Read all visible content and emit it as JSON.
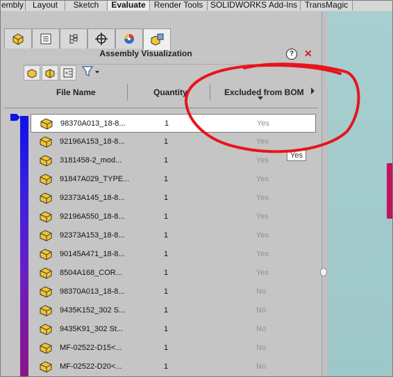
{
  "top_tabs": [
    {
      "label": "embly",
      "active": false
    },
    {
      "label": "Layout",
      "active": false
    },
    {
      "label": "Sketch",
      "active": false
    },
    {
      "label": "Evaluate",
      "active": true
    },
    {
      "label": "Render Tools",
      "active": false
    },
    {
      "label": "SOLIDWORKS Add-Ins",
      "active": false
    },
    {
      "label": "TransMagic",
      "active": false
    }
  ],
  "panel": {
    "title": "Assembly Visualization",
    "help_label": "?",
    "close_label": "✕",
    "icon_tabs": [
      "featuremanager-icon",
      "propertymanager-icon",
      "configurationmanager-icon",
      "dimxpert-icon",
      "display-manager-icon",
      "assembly-visualization-icon"
    ]
  },
  "columns": {
    "file_name": "File Name",
    "quantity": "Quantity",
    "excluded": "Excluded from BOM"
  },
  "tooltip": "Yes",
  "rows": [
    {
      "name": "98370A013_18-8...",
      "qty": "1",
      "excluded": "Yes",
      "selected": true
    },
    {
      "name": "92196A153_18-8...",
      "qty": "1",
      "excluded": "Yes",
      "selected": false
    },
    {
      "name": "3181458-2_mod...",
      "qty": "1",
      "excluded": "Yes",
      "selected": false
    },
    {
      "name": "91847A029_TYPE...",
      "qty": "1",
      "excluded": "Yes",
      "selected": false
    },
    {
      "name": "92373A145_18-8...",
      "qty": "1",
      "excluded": "Yes",
      "selected": false
    },
    {
      "name": "92196A550_18-8...",
      "qty": "1",
      "excluded": "Yes",
      "selected": false
    },
    {
      "name": "92373A153_18-8...",
      "qty": "1",
      "excluded": "Yes",
      "selected": false
    },
    {
      "name": "90145A471_18-8...",
      "qty": "1",
      "excluded": "Yes",
      "selected": false
    },
    {
      "name": "8504A168_COR...",
      "qty": "1",
      "excluded": "Yes",
      "selected": false
    },
    {
      "name": "98370A013_18-8...",
      "qty": "1",
      "excluded": "No",
      "selected": false
    },
    {
      "name": "9435K152_302 S...",
      "qty": "1",
      "excluded": "No",
      "selected": false
    },
    {
      "name": "9435K91_302 St...",
      "qty": "1",
      "excluded": "No",
      "selected": false
    },
    {
      "name": "MF-02522-D15<...",
      "qty": "1",
      "excluded": "No",
      "selected": false
    },
    {
      "name": "MF-02522-D20<...",
      "qty": "1",
      "excluded": "No",
      "selected": false
    }
  ],
  "colors": {
    "annotation": "#e8141c",
    "gradient_top": "#0f12e6",
    "gradient_bottom": "#8a1685"
  }
}
